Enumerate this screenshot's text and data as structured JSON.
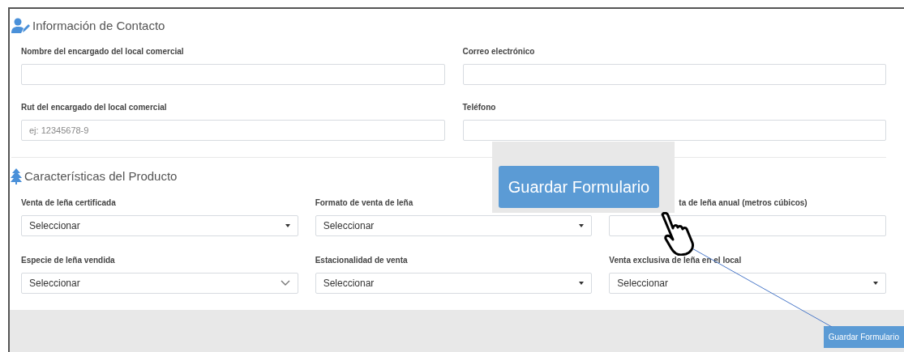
{
  "contact": {
    "title": "Información de Contacto",
    "fields": [
      {
        "label": "Nombre del encargado del local comercial",
        "kind": "input"
      },
      {
        "label": "Correo electrónico",
        "kind": "input"
      },
      {
        "label": "Rut del encargado del local comercial",
        "kind": "input",
        "placeholder": "ej: 12345678-9"
      },
      {
        "label": "Teléfono",
        "kind": "input"
      }
    ]
  },
  "product": {
    "title": "Características del Producto",
    "fields": [
      {
        "label": "Venta de leña certificada",
        "kind": "select-triangle",
        "value": "Seleccionar"
      },
      {
        "label": "Formato de venta de leña",
        "kind": "select-triangle",
        "value": "Seleccionar"
      },
      {
        "label": "ta de leña anual (metros cúbicos)",
        "kind": "input",
        "covered": true
      },
      {
        "label": "Especie de leña vendida",
        "kind": "select-chevron",
        "value": "Seleccionar"
      },
      {
        "label": "Estacionalidad de venta",
        "kind": "select-triangle",
        "value": "Seleccionar"
      },
      {
        "label": "Venta exclusiva de leña en el local",
        "kind": "select-triangle",
        "value": "Seleccionar"
      }
    ]
  },
  "footer": {
    "button": "Guardar Formulario"
  },
  "callout": {
    "button": "Guardar Formulario"
  }
}
